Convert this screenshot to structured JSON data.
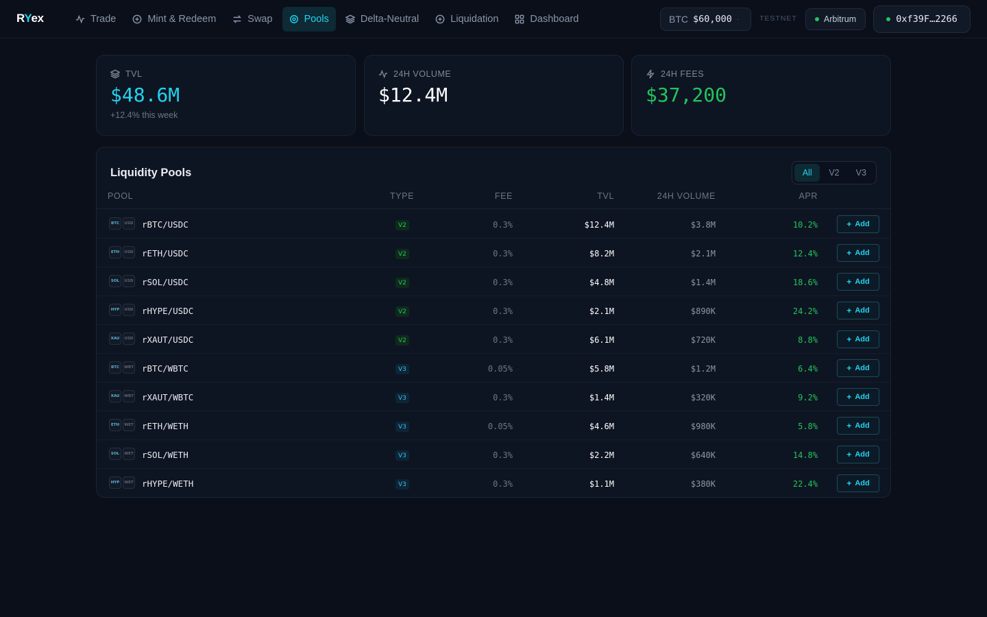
{
  "app": {
    "logo_prefix": "R",
    "logo_y": "Y",
    "logo_suffix": "ex"
  },
  "nav": {
    "items": [
      {
        "label": "Trade",
        "icon": "activity-icon"
      },
      {
        "label": "Mint & Redeem",
        "icon": "plus-circle-icon"
      },
      {
        "label": "Swap",
        "icon": "swap-icon"
      },
      {
        "label": "Pools",
        "icon": "target-icon"
      },
      {
        "label": "Delta-Neutral",
        "icon": "layers-icon"
      },
      {
        "label": "Liquidation",
        "icon": "plus-circle-icon"
      },
      {
        "label": "Dashboard",
        "icon": "grid-icon"
      }
    ],
    "active": "Pools"
  },
  "header": {
    "btc_symbol": "BTC",
    "btc_price": "$60,000",
    "btc_dot": "·",
    "testnet_label": "TESTNET",
    "network": "Arbitrum",
    "wallet": "0xf39F…2266"
  },
  "stats": {
    "tvl": {
      "label": "TVL",
      "value": "$48.6M",
      "sub": "+12.4% this week",
      "color": "#22d3ee"
    },
    "volume": {
      "label": "24H VOLUME",
      "value": "$12.4M",
      "color": "#ffffff"
    },
    "fees": {
      "label": "24H FEES",
      "value": "$37,200",
      "color": "#22c55e"
    }
  },
  "pools": {
    "title": "Liquidity Pools",
    "filters": [
      "All",
      "V2",
      "V3"
    ],
    "active_filter": "All",
    "columns": {
      "pool": "POOL",
      "type": "TYPE",
      "fee": "FEE",
      "tvl": "TVL",
      "volume": "24H VOLUME",
      "apr": "APR"
    },
    "add_label": "Add",
    "rows": [
      {
        "base": "BTC",
        "quote": "USD",
        "pair": "rBTC/USDC",
        "type": "V2",
        "fee": "0.3%",
        "tvl": "$12.4M",
        "volume": "$3.8M",
        "apr": "10.2%"
      },
      {
        "base": "ETH",
        "quote": "USD",
        "pair": "rETH/USDC",
        "type": "V2",
        "fee": "0.3%",
        "tvl": "$8.2M",
        "volume": "$2.1M",
        "apr": "12.4%"
      },
      {
        "base": "SOL",
        "quote": "USD",
        "pair": "rSOL/USDC",
        "type": "V2",
        "fee": "0.3%",
        "tvl": "$4.8M",
        "volume": "$1.4M",
        "apr": "18.6%"
      },
      {
        "base": "HYP",
        "quote": "USD",
        "pair": "rHYPE/USDC",
        "type": "V2",
        "fee": "0.3%",
        "tvl": "$2.1M",
        "volume": "$890K",
        "apr": "24.2%"
      },
      {
        "base": "XAU",
        "quote": "USD",
        "pair": "rXAUT/USDC",
        "type": "V2",
        "fee": "0.3%",
        "tvl": "$6.1M",
        "volume": "$720K",
        "apr": "8.8%"
      },
      {
        "base": "BTC",
        "quote": "WBT",
        "pair": "rBTC/WBTC",
        "type": "V3",
        "fee": "0.05%",
        "tvl": "$5.8M",
        "volume": "$1.2M",
        "apr": "6.4%"
      },
      {
        "base": "XAU",
        "quote": "WBT",
        "pair": "rXAUT/WBTC",
        "type": "V3",
        "fee": "0.3%",
        "tvl": "$1.4M",
        "volume": "$320K",
        "apr": "9.2%"
      },
      {
        "base": "ETH",
        "quote": "WET",
        "pair": "rETH/WETH",
        "type": "V3",
        "fee": "0.05%",
        "tvl": "$4.6M",
        "volume": "$980K",
        "apr": "5.8%"
      },
      {
        "base": "SOL",
        "quote": "WET",
        "pair": "rSOL/WETH",
        "type": "V3",
        "fee": "0.3%",
        "tvl": "$2.2M",
        "volume": "$640K",
        "apr": "14.8%"
      },
      {
        "base": "HYP",
        "quote": "WET",
        "pair": "rHYPE/WETH",
        "type": "V3",
        "fee": "0.3%",
        "tvl": "$1.1M",
        "volume": "$380K",
        "apr": "22.4%"
      }
    ]
  }
}
